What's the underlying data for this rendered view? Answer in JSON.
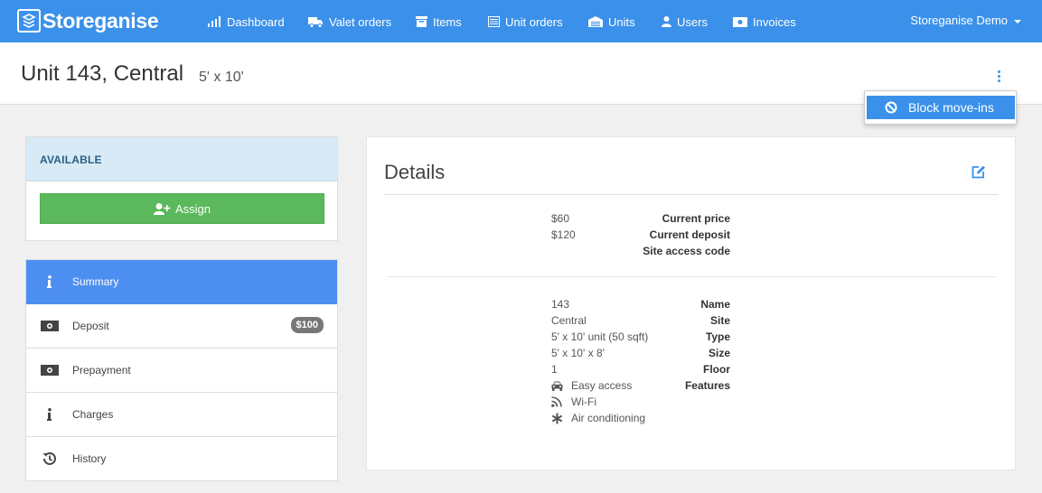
{
  "app": {
    "brand": "Storeganise",
    "account": "Storeganise Demo"
  },
  "nav": [
    {
      "label": "Dashboard",
      "icon": "bar-chart-icon"
    },
    {
      "label": "Valet orders",
      "icon": "truck-icon"
    },
    {
      "label": "Items",
      "icon": "archive-icon"
    },
    {
      "label": "Unit orders",
      "icon": "list-icon"
    },
    {
      "label": "Units",
      "icon": "warehouse-icon"
    },
    {
      "label": "Users",
      "icon": "user-icon"
    },
    {
      "label": "Invoices",
      "icon": "money-icon"
    }
  ],
  "header": {
    "title": "Unit 143, Central",
    "size": "5' x 10'"
  },
  "dropdown": {
    "item": "Block move-ins"
  },
  "status": {
    "label": "AVAILABLE",
    "assign_label": "Assign"
  },
  "menu": [
    {
      "label": "Summary",
      "icon": "info-icon",
      "active": true
    },
    {
      "label": "Deposit",
      "icon": "money-icon",
      "badge": "$100"
    },
    {
      "label": "Prepayment",
      "icon": "money-icon"
    },
    {
      "label": "Charges",
      "icon": "info-icon"
    },
    {
      "label": "History",
      "icon": "history-icon"
    }
  ],
  "details": {
    "title": "Details",
    "pricing": [
      {
        "label": "Current price",
        "value": "$60"
      },
      {
        "label": "Current deposit",
        "value": "$120"
      },
      {
        "label": "Site access code",
        "value": ""
      }
    ],
    "unit": [
      {
        "label": "Name",
        "value": "143"
      },
      {
        "label": "Site",
        "value": "Central"
      },
      {
        "label": "Type",
        "value": "5' x 10' unit (50 sqft)"
      },
      {
        "label": "Size",
        "value": "5' x 10' x 8'"
      },
      {
        "label": "Floor",
        "value": "1"
      }
    ],
    "features_label": "Features",
    "features": [
      {
        "label": "Easy access",
        "icon": "car-icon"
      },
      {
        "label": "Wi-Fi",
        "icon": "rss-icon"
      },
      {
        "label": "Air conditioning",
        "icon": "asterisk-icon"
      }
    ]
  },
  "colors": {
    "primary": "#3b91ea",
    "success": "#5cb85c",
    "active_menu": "#4d8ff0",
    "status_bg": "#d8eaf5"
  }
}
